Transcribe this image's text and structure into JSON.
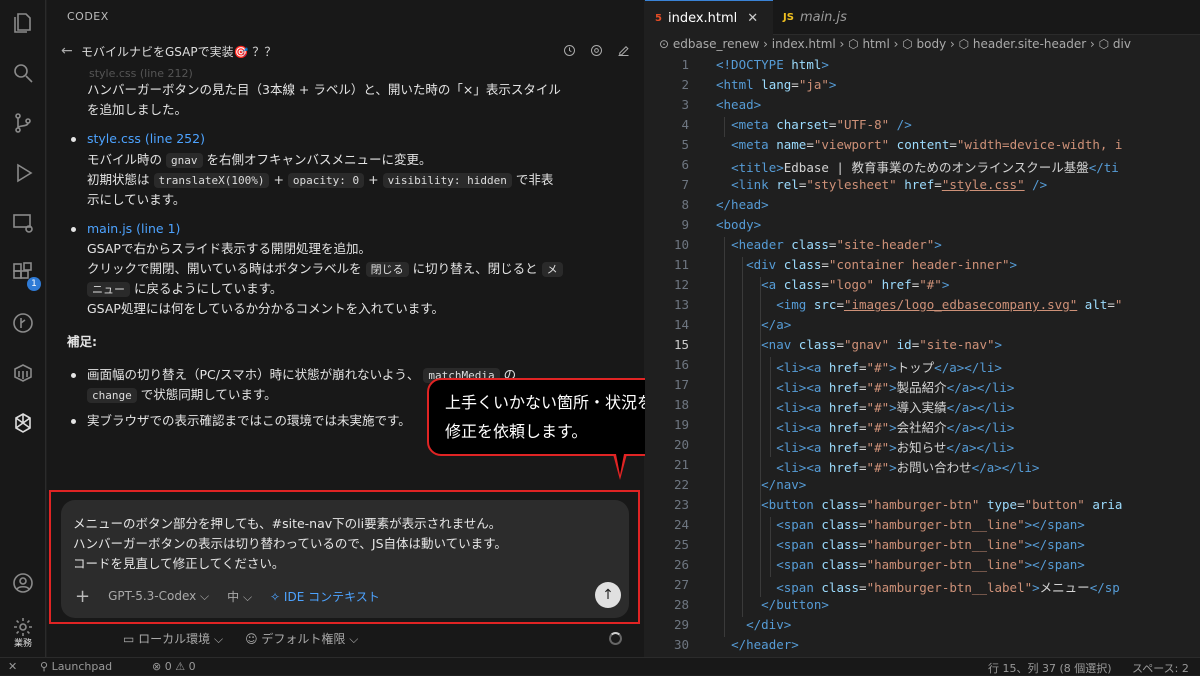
{
  "activity": {
    "extensions_badge": "1",
    "bottom_label": "業務"
  },
  "codex": {
    "title": "CODEX",
    "thread_name": "モバイルナビをGSAPで実装🎯 ？？",
    "faded_line": "style.css (line 212)",
    "msg1_line1": "ハンバーガーボタンの見た目（3本線 + ラベル）と、開いた時の「×」表示スタイル",
    "msg1_line2": "を追加しました。",
    "b1_link": "style.css (line 252)",
    "b1_l1a": "モバイル時の",
    "b1_l1code": "gnav",
    "b1_l1b": "を右側オフキャンバスメニューに変更。",
    "b1_l2a": "初期状態は",
    "b1_code1": "translateX(100%)",
    "b1_plus": "+",
    "b1_code2": "opacity: 0",
    "b1_code3": "visibility: hidden",
    "b1_l2b": "で非表",
    "b1_l3": "示にしています。",
    "b2_link": "main.js (line 1)",
    "b2_l1": "GSAPで右からスライド表示する開閉処理を追加。",
    "b2_l2a": "クリックで開閉、開いている時はボタンラベルを",
    "b2_code1": "閉じる",
    "b2_l2b": "に切り替え、閉じると",
    "b2_code2a": "メ",
    "b2_code2b": "ニュー",
    "b2_l3b": "に戻るようにしています。",
    "b2_l4": "GSAP処理には何をしているか分かるコメントを入れています。",
    "supp_title": "補足:",
    "s1_a": "画面幅の切り替え（PC/スマホ）時に状態が崩れないよう、",
    "s1_code": "matchMedia",
    "s1_b": "の",
    "s1_code2": "change",
    "s1_c": "で状態同期しています。",
    "s2": "実ブラウザでの表示確認まではこの環境では未実施です。",
    "input_lines": [
      "メニューのボタン部分を押しても、#site-nav下のli要素が表示されません。",
      "ハンバーガーボタンの表示は切り替わっているので、JS自体は動いています。",
      "コードを見直して修正してください。"
    ],
    "model": "GPT-5.3-Codex ⌵",
    "reasoning": "中 ⌵",
    "ide_context": "IDE コンテキスト",
    "env": "ローカル環境 ⌵",
    "permission": "デフォルト権限 ⌵"
  },
  "callout": {
    "line1": "上手くいかない箇所・状況を説明して",
    "line2": "修正を依頼します。"
  },
  "editor": {
    "tab_active": "index.html",
    "tab_inactive": "main.js",
    "breadcrumb": "⊙ edbase_renew  ›  index.html  ›  ⬡ html  ›  ⬡ body  ›  ⬡ header.site-header  ›  ⬡ div",
    "line_numbers": [
      "1",
      "2",
      "3",
      "4",
      "5",
      "6",
      "7",
      "8",
      "9",
      "10",
      "11",
      "12",
      "13",
      "14",
      "15",
      "16",
      "17",
      "18",
      "19",
      "20",
      "21",
      "22",
      "23",
      "24",
      "25",
      "26",
      "27",
      "28",
      "29",
      "30"
    ]
  },
  "status": {
    "left": "⊗ 0 ⚠ 0",
    "launchpad": "Launchpad",
    "position": "行 15、列 37 (8 個選択)",
    "spaces": "スペース: 2"
  },
  "colors": {
    "accent_red": "#e02424",
    "link_blue": "#4da3ff",
    "tag_blue": "#569cd6",
    "attr": "#9cdcfe",
    "string": "#ce9178"
  }
}
